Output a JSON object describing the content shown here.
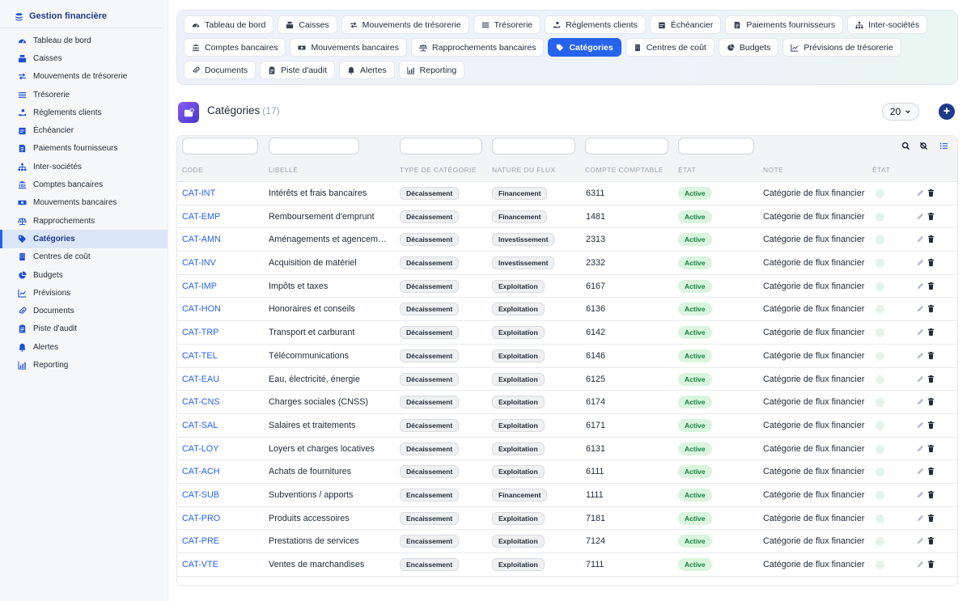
{
  "sidebar": {
    "brand": "Gestion financière",
    "items": [
      {
        "label": "Tableau de bord",
        "icon": "dashboard-icon"
      },
      {
        "label": "Caisses",
        "icon": "cash-register-icon"
      },
      {
        "label": "Mouvements de trésorerie",
        "icon": "exchange-icon"
      },
      {
        "label": "Trésorerie",
        "icon": "list-icon"
      },
      {
        "label": "Règlements clients",
        "icon": "hand-money-icon"
      },
      {
        "label": "Échéancier",
        "icon": "calendar-icon"
      },
      {
        "label": "Paiements fournisseurs",
        "icon": "invoice-icon"
      },
      {
        "label": "Inter-sociétés",
        "icon": "sitemap-icon"
      },
      {
        "label": "Comptes bancaires",
        "icon": "bank-icon"
      },
      {
        "label": "Mouvements bancaires",
        "icon": "money-bill-icon"
      },
      {
        "label": "Rapprochements",
        "icon": "scale-icon"
      },
      {
        "label": "Catégories",
        "icon": "tags-icon",
        "active": true
      },
      {
        "label": "Centres de coût",
        "icon": "building-icon"
      },
      {
        "label": "Budgets",
        "icon": "pie-chart-icon"
      },
      {
        "label": "Prévisions",
        "icon": "trend-icon"
      },
      {
        "label": "Documents",
        "icon": "paperclip-icon"
      },
      {
        "label": "Piste d'audit",
        "icon": "clipboard-icon"
      },
      {
        "label": "Alertes",
        "icon": "bell-icon"
      },
      {
        "label": "Reporting",
        "icon": "chart-icon"
      }
    ]
  },
  "tabs": [
    {
      "label": "Tableau de bord",
      "icon": "dashboard-icon"
    },
    {
      "label": "Caisses",
      "icon": "cash-register-icon"
    },
    {
      "label": "Mouvements de trésorerie",
      "icon": "exchange-icon"
    },
    {
      "label": "Trésorerie",
      "icon": "list-icon"
    },
    {
      "label": "Règlements clients",
      "icon": "hand-money-icon"
    },
    {
      "label": "Échéancier",
      "icon": "calendar-icon"
    },
    {
      "label": "Paiements fournisseurs",
      "icon": "invoice-icon"
    },
    {
      "label": "Inter-sociétés",
      "icon": "sitemap-icon"
    },
    {
      "label": "Comptes bancaires",
      "icon": "bank-icon"
    },
    {
      "label": "Mouvements bancaires",
      "icon": "money-bill-icon"
    },
    {
      "label": "Rapprochements bancaires",
      "icon": "scale-icon"
    },
    {
      "label": "Catégories",
      "icon": "tags-icon",
      "active": true
    },
    {
      "label": "Centres de coût",
      "icon": "building-icon"
    },
    {
      "label": "Budgets",
      "icon": "pie-chart-icon"
    },
    {
      "label": "Prévisions de trésorerie",
      "icon": "trend-icon"
    },
    {
      "label": "Documents",
      "icon": "paperclip-icon"
    },
    {
      "label": "Piste d'audit",
      "icon": "clipboard-icon"
    },
    {
      "label": "Alertes",
      "icon": "bell-icon"
    },
    {
      "label": "Reporting",
      "icon": "chart-icon"
    }
  ],
  "page": {
    "title": "Catégories",
    "count": "(17)",
    "page_size": "20"
  },
  "table": {
    "columns": [
      "Code",
      "Libellé",
      "Type de catégorie",
      "Nature du flux",
      "Compte comptable",
      "État",
      "Note",
      "État"
    ],
    "rows": [
      {
        "code": "CAT-INT",
        "label": "Intérêts et frais bancaires",
        "type": "Décaissement",
        "nature": "Financement",
        "account": "6311",
        "status": "Active",
        "note": "Catégorie de flux financier"
      },
      {
        "code": "CAT-EMP",
        "label": "Remboursement d'emprunt",
        "type": "Décaissement",
        "nature": "Financement",
        "account": "1481",
        "status": "Active",
        "note": "Catégorie de flux financier"
      },
      {
        "code": "CAT-AMN",
        "label": "Aménagements et agencements",
        "type": "Décaissement",
        "nature": "Investissement",
        "account": "2313",
        "status": "Active",
        "note": "Catégorie de flux financier"
      },
      {
        "code": "CAT-INV",
        "label": "Acquisition de matériel",
        "type": "Décaissement",
        "nature": "Investissement",
        "account": "2332",
        "status": "Active",
        "note": "Catégorie de flux financier"
      },
      {
        "code": "CAT-IMP",
        "label": "Impôts et taxes",
        "type": "Décaissement",
        "nature": "Exploitation",
        "account": "6167",
        "status": "Active",
        "note": "Catégorie de flux financier"
      },
      {
        "code": "CAT-HON",
        "label": "Honoraires et conseils",
        "type": "Décaissement",
        "nature": "Exploitation",
        "account": "6136",
        "status": "Active",
        "note": "Catégorie de flux financier"
      },
      {
        "code": "CAT-TRP",
        "label": "Transport et carburant",
        "type": "Décaissement",
        "nature": "Exploitation",
        "account": "6142",
        "status": "Active",
        "note": "Catégorie de flux financier"
      },
      {
        "code": "CAT-TEL",
        "label": "Télécommunications",
        "type": "Décaissement",
        "nature": "Exploitation",
        "account": "6146",
        "status": "Active",
        "note": "Catégorie de flux financier"
      },
      {
        "code": "CAT-EAU",
        "label": "Eau, électricité, énergie",
        "type": "Décaissement",
        "nature": "Exploitation",
        "account": "6125",
        "status": "Active",
        "note": "Catégorie de flux financier"
      },
      {
        "code": "CAT-CNS",
        "label": "Charges sociales (CNSS)",
        "type": "Décaissement",
        "nature": "Exploitation",
        "account": "6174",
        "status": "Active",
        "note": "Catégorie de flux financier"
      },
      {
        "code": "CAT-SAL",
        "label": "Salaires et traitements",
        "type": "Décaissement",
        "nature": "Exploitation",
        "account": "6171",
        "status": "Active",
        "note": "Catégorie de flux financier"
      },
      {
        "code": "CAT-LOY",
        "label": "Loyers et charges locatives",
        "type": "Décaissement",
        "nature": "Exploitation",
        "account": "6131",
        "status": "Active",
        "note": "Catégorie de flux financier"
      },
      {
        "code": "CAT-ACH",
        "label": "Achats de fournitures",
        "type": "Décaissement",
        "nature": "Exploitation",
        "account": "6111",
        "status": "Active",
        "note": "Catégorie de flux financier"
      },
      {
        "code": "CAT-SUB",
        "label": "Subventions / apports",
        "type": "Encaissement",
        "nature": "Financement",
        "account": "1111",
        "status": "Active",
        "note": "Catégorie de flux financier"
      },
      {
        "code": "CAT-PRO",
        "label": "Produits accessoires",
        "type": "Encaissement",
        "nature": "Exploitation",
        "account": "7181",
        "status": "Active",
        "note": "Catégorie de flux financier"
      },
      {
        "code": "CAT-PRE",
        "label": "Prestations de services",
        "type": "Encaissement",
        "nature": "Exploitation",
        "account": "7124",
        "status": "Active",
        "note": "Catégorie de flux financier"
      },
      {
        "code": "CAT-VTE",
        "label": "Ventes de marchandises",
        "type": "Encaissement",
        "nature": "Exploitation",
        "account": "7111",
        "status": "Active",
        "note": "Catégorie de flux financier"
      }
    ]
  },
  "colors": {
    "accent": "#2563eb",
    "brand": "#1e3a8a",
    "active_badge_bg": "#d9f5dd",
    "active_badge_text": "#15803d"
  }
}
